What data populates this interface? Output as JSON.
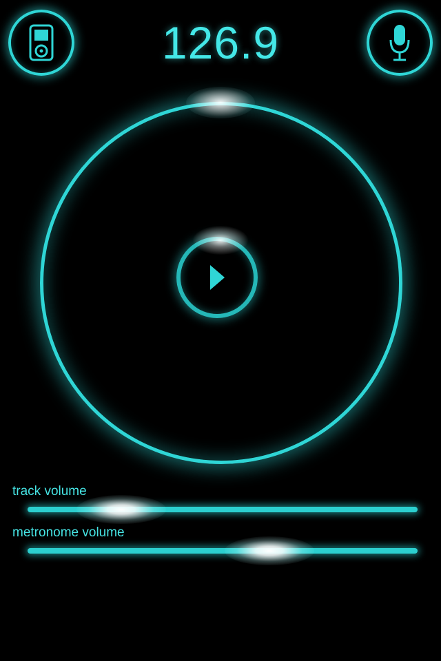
{
  "header": {
    "bpm": "126.9",
    "left_button_icon": "ipod-icon",
    "right_button_icon": "microphone-icon"
  },
  "player": {
    "play_icon": "play-icon"
  },
  "sliders": {
    "track_volume": {
      "label": "track volume",
      "value": 0.24
    },
    "metronome_volume": {
      "label": "metronome volume",
      "value": 0.62
    }
  },
  "colors": {
    "accent": "#2fd6d6",
    "background": "#000000",
    "highlight": "#ffffff"
  }
}
